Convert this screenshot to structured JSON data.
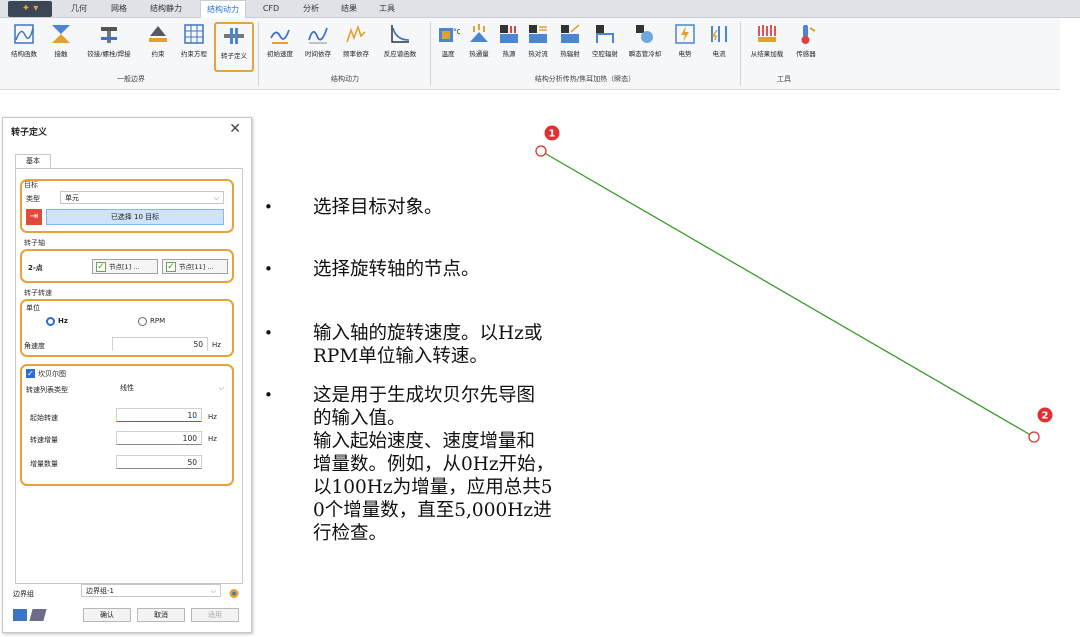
{
  "menu": {
    "tabs": [
      "几何",
      "网格",
      "结构静力",
      "结构动力",
      "CFD",
      "分析",
      "结果",
      "工具"
    ],
    "active": "结构动力"
  },
  "ribbon": {
    "groups": [
      {
        "label": "一般边界",
        "buttons": [
          "结构函数",
          "接触",
          "铰接/螺栓/焊接",
          "约束",
          "约束方程",
          "转子定义"
        ]
      },
      {
        "label": "结构动力",
        "buttons": [
          "初始速度",
          "时间依存",
          "频率依存",
          "反应谱函数"
        ]
      },
      {
        "label": "结构分析传热/焦耳加热（瞬态）",
        "buttons": [
          "温度",
          "热通量",
          "热源",
          "热对流",
          "热辐射",
          "空腔辐射",
          "瞬态管冷却",
          "电势",
          "电流"
        ]
      },
      {
        "label": "工具",
        "buttons": [
          "从结果加载",
          "传感器"
        ]
      }
    ],
    "highlighted": "转子定义"
  },
  "dialog": {
    "title": "转子定义",
    "tab": "基本",
    "target": {
      "section": "目标",
      "type_label": "类型",
      "type_value": "单元",
      "selected": "已选择 10 目标"
    },
    "axis": {
      "section": "转子轴",
      "method": "2-点",
      "node1": "节点[1] ...",
      "node2": "节点[11] ..."
    },
    "speed": {
      "section": "转子转速",
      "unit_label": "单位",
      "opt_hz": "Hz",
      "opt_rpm": "RPM",
      "selected": "Hz",
      "angle_label": "角速度",
      "angle_value": "50",
      "angle_unit": "Hz"
    },
    "campbell": {
      "check_label": "坎贝尔图",
      "list_type_label": "转速列表类型",
      "list_type_value": "线性",
      "start_label": "起始转速",
      "start_value": "10",
      "start_unit": "Hz",
      "inc_label": "转速增量",
      "inc_value": "100",
      "inc_unit": "Hz",
      "count_label": "增量数量",
      "count_value": "50"
    },
    "boundary": {
      "label": "边界组",
      "value": "边界组-1"
    },
    "buttons": {
      "ok": "确认",
      "cancel": "取消",
      "apply": "适用"
    }
  },
  "bullets": [
    "选择目标对象。",
    "选择旋转轴的节点。",
    "输入轴的旋转速度。以Hz或\nRPM单位输入转速。",
    "这是用于生成坎贝尔先导图\n的输入值。\n输入起始速度、速度增量和\n增量数。例如，从0Hz开始，\n以100Hz为增量，应用总共5\n0个增量数，直至5,000Hz进\n行检查。"
  ],
  "viewport": {
    "marker1": "1",
    "marker2": "2",
    "line_color": "#3a9a2a",
    "marker_color": "#e03030"
  }
}
